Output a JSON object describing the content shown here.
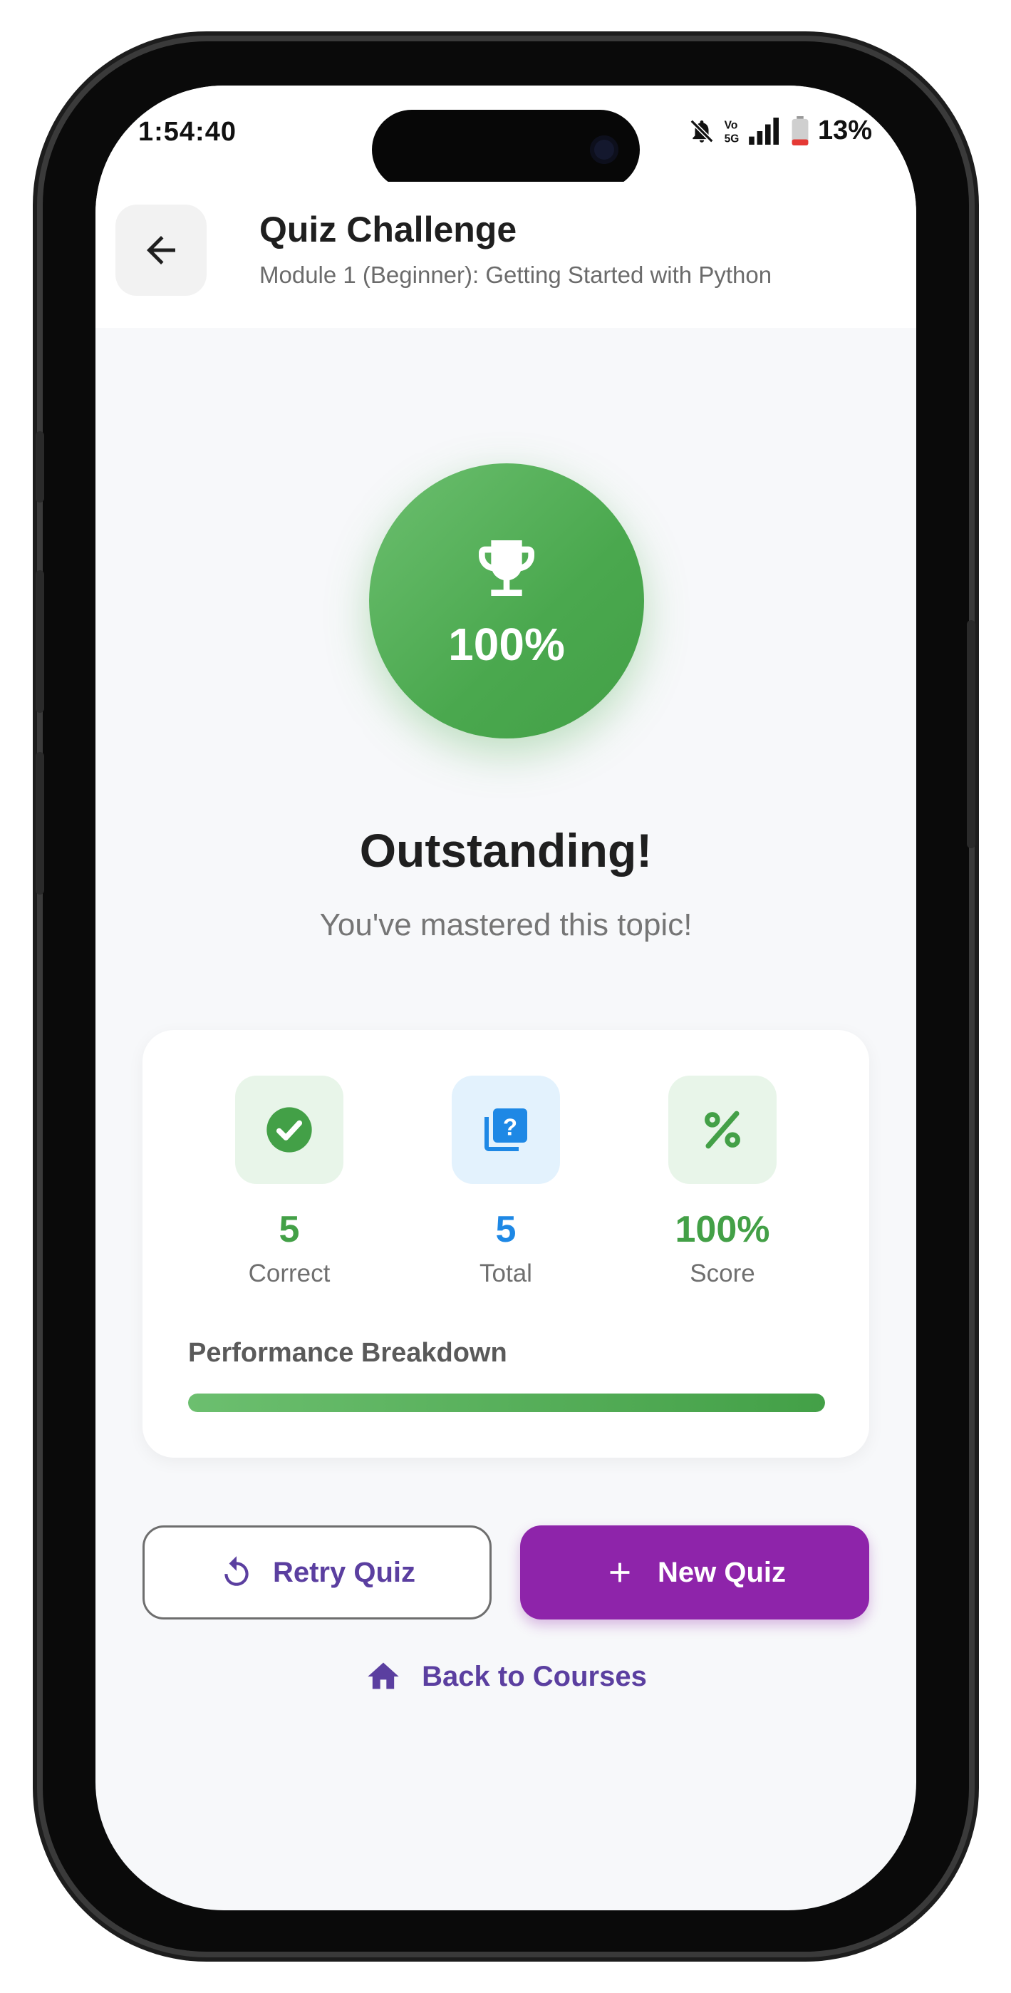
{
  "status_bar": {
    "time": "1:54:40",
    "battery": "13%",
    "icons": [
      "mute-bell-icon",
      "volte-5g-icon",
      "signal-icon",
      "battery-icon"
    ]
  },
  "header": {
    "title": "Quiz Challenge",
    "subtitle": "Module 1 (Beginner): Getting Started with Python",
    "back_icon": "arrow-left-icon"
  },
  "result": {
    "score_percent": "100%",
    "icon": "trophy-icon",
    "headline": "Outstanding!",
    "message": "You've mastered this topic!"
  },
  "stats": {
    "correct": {
      "value": "5",
      "label": "Correct",
      "icon": "check-circle-icon"
    },
    "total": {
      "value": "5",
      "label": "Total",
      "icon": "quiz-icon"
    },
    "score": {
      "value": "100%",
      "label": "Score",
      "icon": "percent-icon"
    }
  },
  "performance": {
    "label": "Performance Breakdown",
    "progress": 1.0
  },
  "actions": {
    "retry_label": "Retry Quiz",
    "new_label": "New Quiz",
    "back_label": "Back to Courses"
  },
  "colors": {
    "green": "#43a047",
    "blue": "#1e88e5",
    "purple_button": "#8e24aa",
    "purple_text": "#5b3fa0"
  }
}
